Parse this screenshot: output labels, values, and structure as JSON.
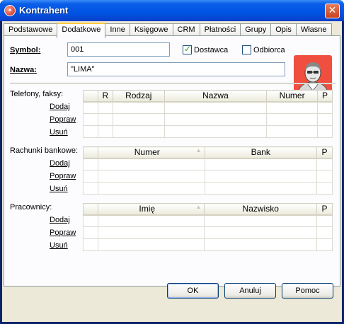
{
  "window": {
    "title": "Kontrahent",
    "icon": "app-logo-icon"
  },
  "tabs": [
    "Podstawowe",
    "Dodatkowe",
    "Inne",
    "Księgowe",
    "CRM",
    "Płatności",
    "Grupy",
    "Opis",
    "Własne"
  ],
  "active_tab": "Dodatkowe",
  "form": {
    "symbol_label": "Symbol:",
    "symbol_value": "001",
    "nazwa_label": "Nazwa:",
    "nazwa_value": "\"LIMA\"",
    "dostawca_label": "Dostawca",
    "dostawca_checked": true,
    "odbiorca_label": "Odbiorca",
    "odbiorca_checked": false
  },
  "actions": {
    "add": "Dodaj",
    "edit": "Popraw",
    "delete": "Usuń"
  },
  "phones": {
    "label": "Telefony, faksy:",
    "columns": [
      "R",
      "Rodzaj",
      "Nazwa",
      "Numer",
      "P"
    ]
  },
  "accounts": {
    "label": "Rachunki bankowe:",
    "columns": [
      "Numer",
      "Bank",
      "P"
    ]
  },
  "employees": {
    "label": "Pracownicy:",
    "columns": [
      "Imię",
      "Nazwisko",
      "P"
    ]
  },
  "buttons": {
    "ok": "OK",
    "cancel": "Anuluj",
    "help": "Pomoc"
  },
  "colors": {
    "titlebar": "#0054e3",
    "active_tab_accent": "#ffc83c",
    "avatar_bg": "#f04e3e"
  }
}
